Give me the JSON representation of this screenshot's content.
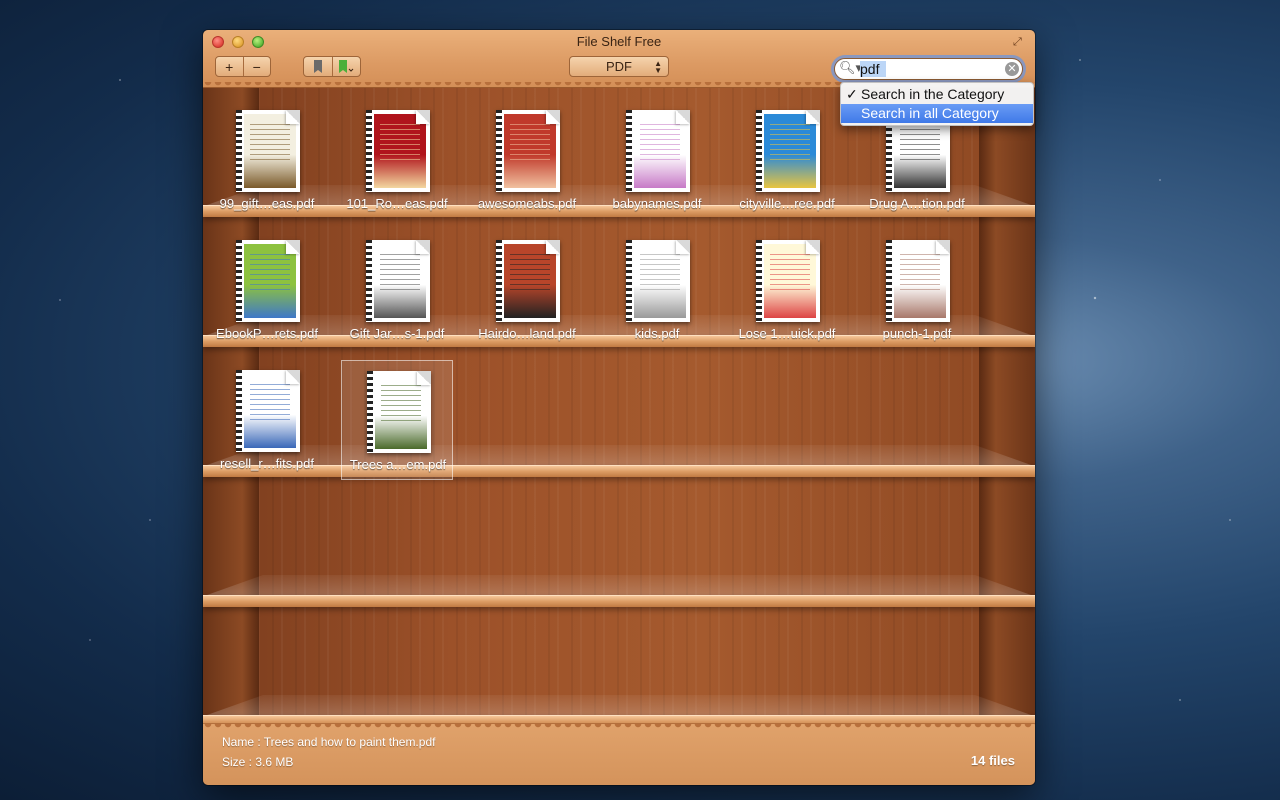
{
  "window": {
    "title": "File Shelf Free"
  },
  "toolbar": {
    "add_label": "+",
    "remove_label": "−",
    "category": "PDF",
    "search_value": "pdf"
  },
  "search_menu": {
    "items": [
      {
        "label": "Search in the Category",
        "checked": true
      },
      {
        "label": "Search in all Category",
        "highlighted": true
      }
    ]
  },
  "files": [
    {
      "label": "99_gift…eas.pdf",
      "cover": "#f3efe0",
      "accent": "#7a5a2a"
    },
    {
      "label": "101_Ro…eas.pdf",
      "cover": "#b0141c",
      "accent": "#f3d7a0"
    },
    {
      "label": "awesomeabs.pdf",
      "cover": "#c0392b",
      "accent": "#f1c1a0"
    },
    {
      "label": "babynames.pdf",
      "cover": "#ffffff",
      "accent": "#c77ac7"
    },
    {
      "label": "cityville…ree.pdf",
      "cover": "#2b8ad8",
      "accent": "#e8c540"
    },
    {
      "label": "Drug A…tion.pdf",
      "cover": "#ffffff",
      "accent": "#333333"
    },
    {
      "label": "EbookP…rets.pdf",
      "cover": "#8dc23f",
      "accent": "#3f78c8"
    },
    {
      "label": "Gift Jar…s-1.pdf",
      "cover": "#ffffff",
      "accent": "#555555"
    },
    {
      "label": "Hairdo…land.pdf",
      "cover": "#b8452a",
      "accent": "#222222"
    },
    {
      "label": "kids.pdf",
      "cover": "#ffffff",
      "accent": "#999999"
    },
    {
      "label": "Lose 1…uick.pdf",
      "cover": "#fff8d8",
      "accent": "#d44"
    },
    {
      "label": "punch-1.pdf",
      "cover": "#ffffff",
      "accent": "#a8786a"
    },
    {
      "label": "resell_r…fits.pdf",
      "cover": "#ffffff",
      "accent": "#3a68b8"
    },
    {
      "label": "Trees a…em.pdf",
      "cover": "#ffffff",
      "accent": "#4a6a2a"
    }
  ],
  "status": {
    "name_line": "Name : Trees and how to paint them.pdf",
    "size_line": "Size   : 3.6 MB",
    "count": "14 files"
  }
}
